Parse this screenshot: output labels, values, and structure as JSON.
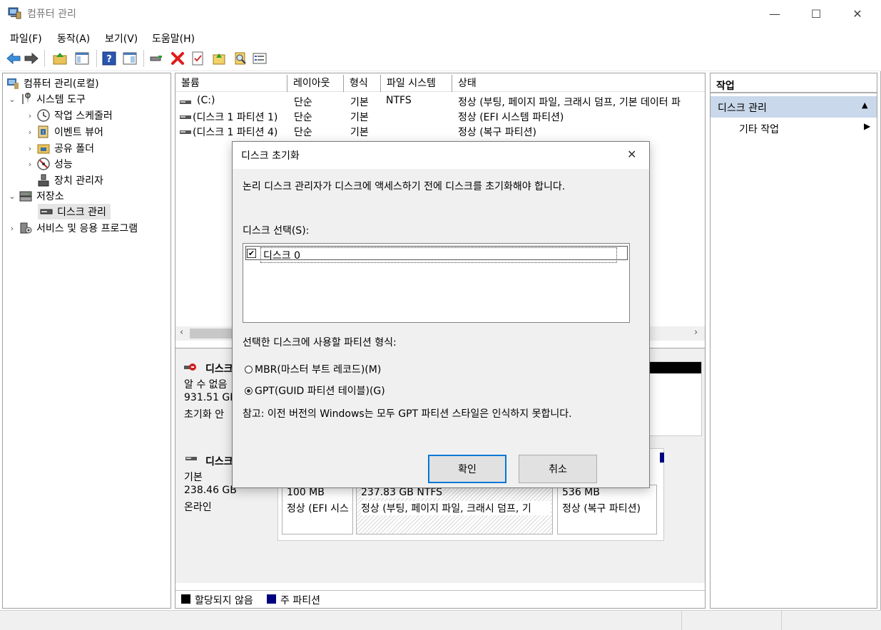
{
  "window": {
    "title": "컴퓨터 관리",
    "minimize": "—",
    "maximize": "☐",
    "close": "✕"
  },
  "menu": [
    "파일(F)",
    "동작(A)",
    "보기(V)",
    "도움말(H)"
  ],
  "colors": {
    "accent": "#0078d7",
    "selected": "#cce8ff",
    "unallocated": "#000000",
    "primary": "#000080",
    "action_header": "#c9d8ea",
    "delete_red": "#e01b1b"
  },
  "tree": {
    "root": "컴퓨터 관리(로컬)",
    "system_tools": "시스템 도구",
    "task_scheduler": "작업 스케줄러",
    "event_viewer": "이벤트 뷰어",
    "shared_folders": "공유 폴더",
    "performance": "성능",
    "device_manager": "장치 관리자",
    "storage": "저장소",
    "disk_management": "디스크 관리",
    "services": "서비스 및 응용 프로그램"
  },
  "volumes": {
    "headers": [
      "볼륨",
      "레이아웃",
      "형식",
      "파일 시스템",
      "상태"
    ],
    "rows": [
      {
        "name": "(C:)",
        "layout": "단순",
        "type": "기본",
        "fs": "NTFS",
        "status": "정상 (부팅, 페이지 파일, 크래시 덤프, 기본 데이터 파"
      },
      {
        "name": "(디스크 1 파티션 1)",
        "layout": "단순",
        "type": "기본",
        "fs": "",
        "status": "정상 (EFI 시스템 파티션)"
      },
      {
        "name": "(디스크 1 파티션 4)",
        "layout": "단순",
        "type": "기본",
        "fs": "",
        "status": "정상 (복구 파티션)"
      }
    ]
  },
  "disks": {
    "disk0": {
      "name": "디스크",
      "type": "알 수 없음",
      "size": "931.51 GB",
      "status": "초기화 안"
    },
    "disk1": {
      "name": "디스크",
      "type": "기본",
      "size": "238.46 GB",
      "status": "온라인",
      "partitions": [
        {
          "size": "100 MB",
          "status": "정상 (EFI 시스"
        },
        {
          "size": "237.83 GB NTFS",
          "status": "정상 (부팅, 페이지 파일, 크래시 덤프, 기"
        },
        {
          "size": "536 MB",
          "status": "정상 (복구 파티션)"
        }
      ]
    }
  },
  "legend": {
    "unallocated": "할당되지 않음",
    "primary": "주 파티션"
  },
  "actions": {
    "header": "작업",
    "section": "디스크 관리",
    "more": "기타 작업"
  },
  "dialog": {
    "title": "디스크 초기화",
    "message": "논리 디스크 관리자가 디스크에 액세스하기 전에 디스크를 초기화해야 합니다.",
    "select_label": "디스크 선택(S):",
    "disk_item": "디스크 0",
    "disk_checked": true,
    "partition_label": "선택한 디스크에 사용할 파티션 형식:",
    "mbr": "MBR(마스터 부트 레코드)(M)",
    "gpt": "GPT(GUID 파티션 테이블)(G)",
    "selected_style": "GPT",
    "note": "참고: 이전 버전의 Windows는 모두 GPT 파티션 스타일은 인식하지 못합니다.",
    "ok": "확인",
    "cancel": "취소"
  }
}
